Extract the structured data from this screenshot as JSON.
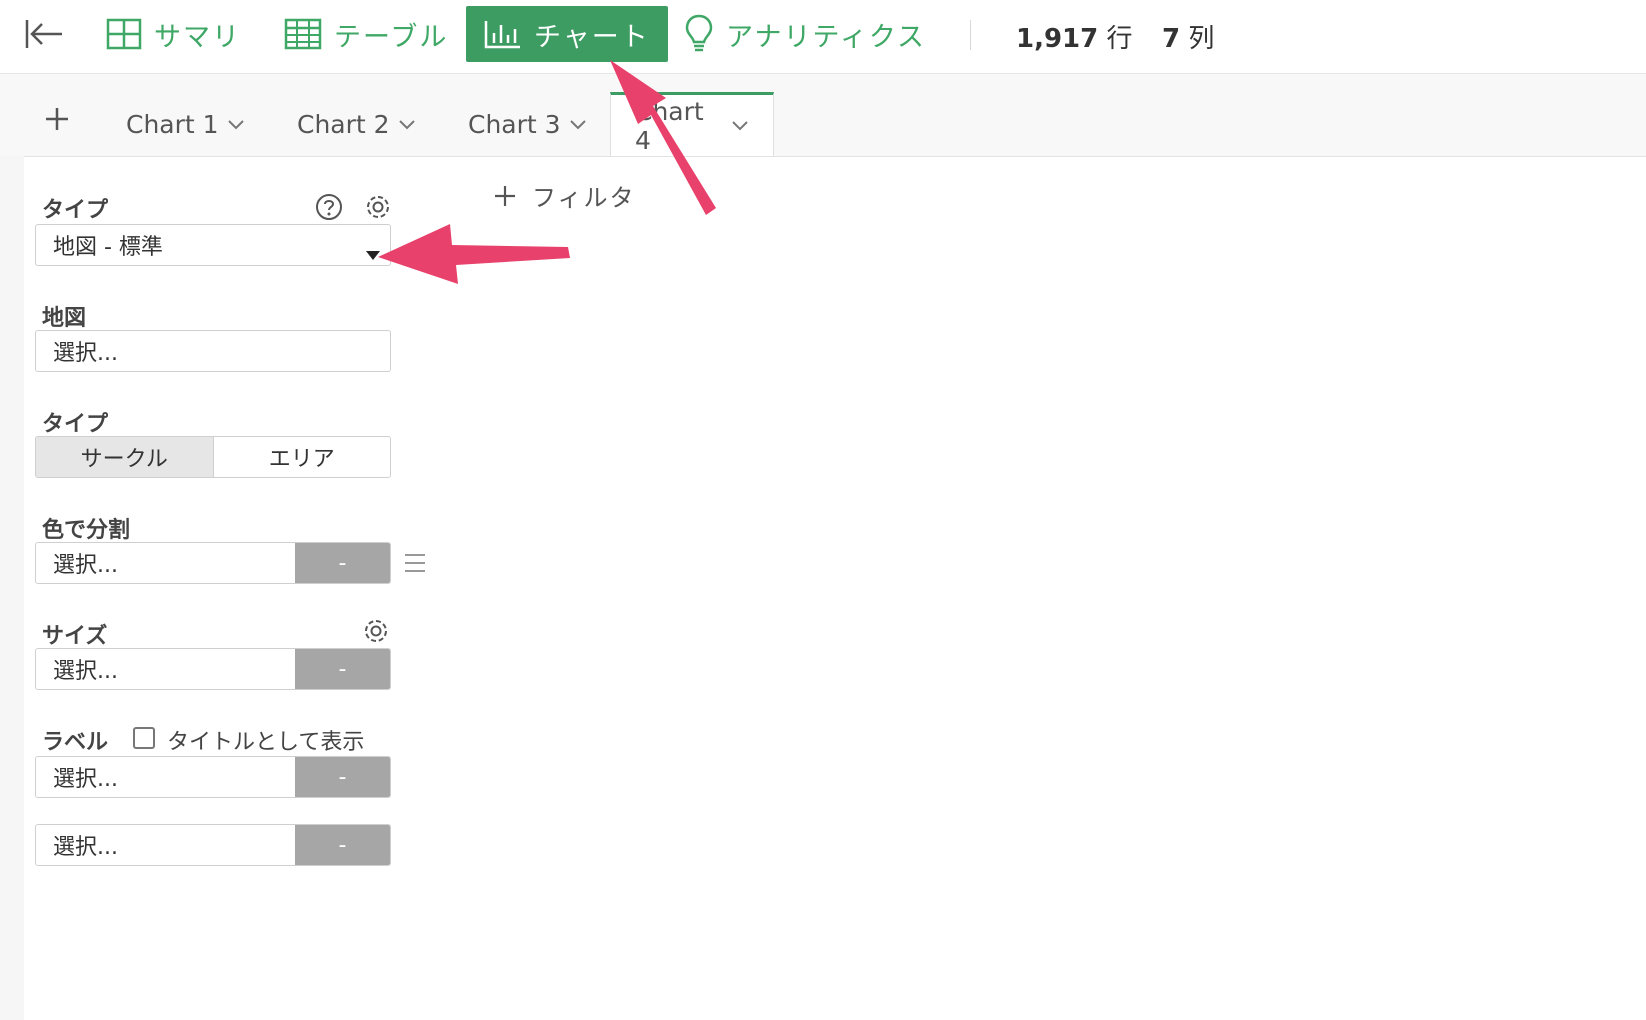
{
  "topbar": {
    "nav": [
      {
        "label": "サマリ",
        "icon": "grid-icon"
      },
      {
        "label": "テーブル",
        "icon": "table-icon"
      },
      {
        "label": "チャート",
        "icon": "bar-chart-icon"
      },
      {
        "label": "アナリティクス",
        "icon": "lightbulb-icon"
      }
    ],
    "rows": {
      "value": "1,917",
      "unit": "行"
    },
    "cols": {
      "value": "7",
      "unit": "列"
    }
  },
  "tabs": [
    "Chart 1",
    "Chart 2",
    "Chart 3",
    "Chart 4"
  ],
  "panel": {
    "type_label": "タイプ",
    "type_value": "地図 - 標準",
    "map_label": "地図",
    "map_placeholder": "選択...",
    "subtype_label": "タイプ",
    "subtype_options": [
      "サークル",
      "エリア"
    ],
    "color_label": "色で分割",
    "color_placeholder": "選択...",
    "size_label": "サイズ",
    "size_placeholder": "選択...",
    "label_label": "ラベル",
    "label_checkbox": "タイトルとして表示",
    "label_placeholder": "選択...",
    "extra_placeholder": "選択...",
    "dash": "-"
  },
  "filter_label": "フィルタ",
  "colors": {
    "accent": "#3d9c62",
    "annotation": "#e8416b"
  }
}
